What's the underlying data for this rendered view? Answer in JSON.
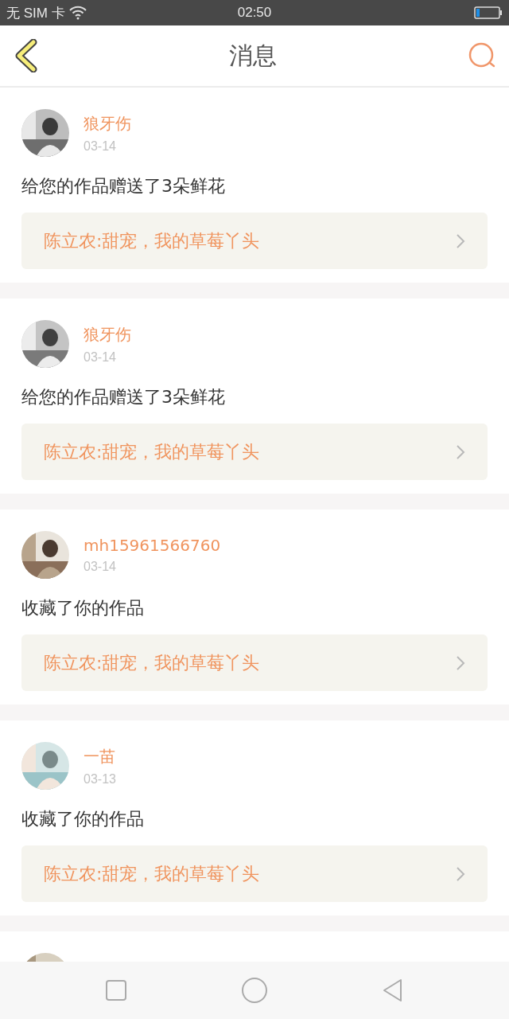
{
  "status_bar": {
    "carrier": "无 SIM 卡",
    "time": "02:50"
  },
  "header": {
    "title": "消息"
  },
  "messages": [
    {
      "kind": "full",
      "user": "狼牙伤",
      "date": "03-14",
      "text": "给您的作品赠送了3朵鲜花",
      "work": "陈立农:甜宠，我的草莓丫头"
    },
    {
      "kind": "full",
      "user": "狼牙伤",
      "date": "03-14",
      "text": "给您的作品赠送了3朵鲜花",
      "work": "陈立农:甜宠，我的草莓丫头"
    },
    {
      "kind": "full",
      "user": "mh15961566760",
      "date": "03-14",
      "text": "收藏了你的作品",
      "work": "陈立农:甜宠，我的草莓丫头"
    },
    {
      "kind": "full",
      "user": "一苗",
      "date": "03-13",
      "text": "收藏了你的作品",
      "work": "陈立农:甜宠，我的草莓丫头"
    },
    {
      "kind": "partial"
    }
  ]
}
